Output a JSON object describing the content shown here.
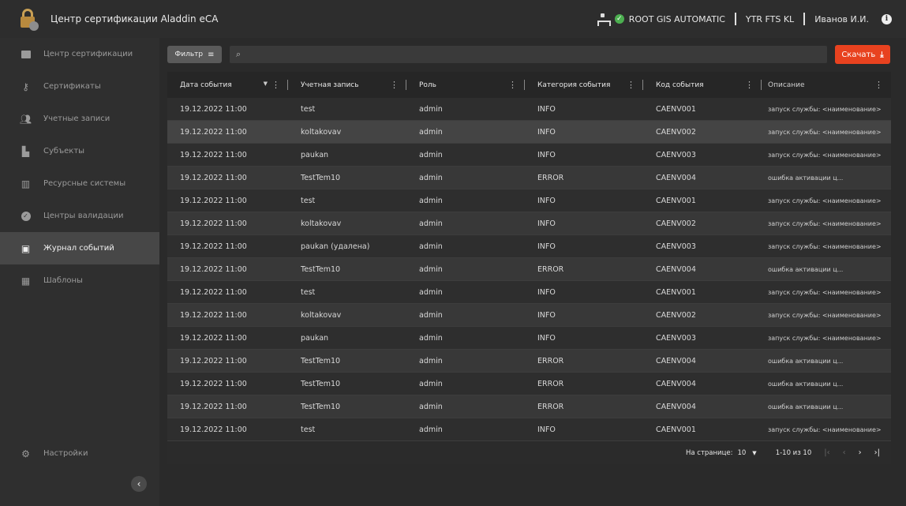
{
  "app": {
    "title": "Центр сертификации Aladdin eCA"
  },
  "header": {
    "status_label": "ROOT GIS AUTOMATIC",
    "org_label": "YTR FTS KL",
    "user_name": "Иванов И.И.",
    "accent_ok": "#4caf50"
  },
  "sidebar": {
    "items": [
      {
        "label": "Центр сертификации",
        "icon": "certificate-center-icon"
      },
      {
        "label": "Сертификаты",
        "icon": "key-icon"
      },
      {
        "label": "Учетные записи",
        "icon": "users-icon"
      },
      {
        "label": "Субъекты",
        "icon": "subjects-icon"
      },
      {
        "label": "Ресурсные системы",
        "icon": "books-icon"
      },
      {
        "label": "Центры валидации",
        "icon": "check-circle-icon"
      },
      {
        "label": "Журнал событий",
        "icon": "journal-icon",
        "active": true
      },
      {
        "label": "Шаблоны",
        "icon": "templates-icon"
      }
    ],
    "settings_label": "Настройки"
  },
  "toolbar": {
    "filter_label": "Фильтр",
    "search_value": "",
    "download_label": "Скачать",
    "download_color": "#e8421f"
  },
  "table": {
    "columns": [
      "Дата события",
      "Учетная запись",
      "Роль",
      "Категория события",
      "Код события",
      "Описание"
    ],
    "rows": [
      [
        "19.12.2022 11:00",
        "test",
        "admin",
        "INFO",
        "CAENV001",
        "запуск службы: <наименование>"
      ],
      [
        "19.12.2022 11:00",
        "koltakovav",
        "admin",
        "INFO",
        "CAENV002",
        "запуск службы: <наименование>"
      ],
      [
        "19.12.2022 11:00",
        "paukan",
        "admin",
        "INFO",
        "CAENV003",
        "запуск службы: <наименование>"
      ],
      [
        "19.12.2022 11:00",
        "TestTem10",
        "admin",
        "ERROR",
        "CAENV004",
        "ошибка активации ц..."
      ],
      [
        "19.12.2022 11:00",
        "test",
        "admin",
        "INFO",
        "CAENV001",
        "запуск службы: <наименование>"
      ],
      [
        "19.12.2022 11:00",
        "koltakovav",
        "admin",
        "INFO",
        "CAENV002",
        "запуск службы: <наименование>"
      ],
      [
        "19.12.2022 11:00",
        "paukan (удалена)",
        "admin",
        "INFO",
        "CAENV003",
        "запуск службы: <наименование>"
      ],
      [
        "19.12.2022 11:00",
        "TestTem10",
        "admin",
        "ERROR",
        "CAENV004",
        "ошибка активации ц..."
      ],
      [
        "19.12.2022 11:00",
        "test",
        "admin",
        "INFO",
        "CAENV001",
        "запуск службы: <наименование>"
      ],
      [
        "19.12.2022 11:00",
        "koltakovav",
        "admin",
        "INFO",
        "CAENV002",
        "запуск службы: <наименование>"
      ],
      [
        "19.12.2022 11:00",
        "paukan",
        "admin",
        "INFO",
        "CAENV003",
        "запуск службы: <наименование>"
      ],
      [
        "19.12.2022 11:00",
        "TestTem10",
        "admin",
        "ERROR",
        "CAENV004",
        "ошибка активации ц..."
      ],
      [
        "19.12.2022 11:00",
        "TestTem10",
        "admin",
        "ERROR",
        "CAENV004",
        "ошибка активации ц..."
      ],
      [
        "19.12.2022 11:00",
        "TestTem10",
        "admin",
        "ERROR",
        "CAENV004",
        "ошибка активации ц..."
      ],
      [
        "19.12.2022 11:00",
        "test",
        "admin",
        "INFO",
        "CAENV001",
        "запуск службы: <наименование>"
      ]
    ],
    "highlighted_row": 1
  },
  "pager": {
    "per_page_label": "На странице:",
    "per_page_value": "10",
    "range_label": "1-10 из 10"
  }
}
